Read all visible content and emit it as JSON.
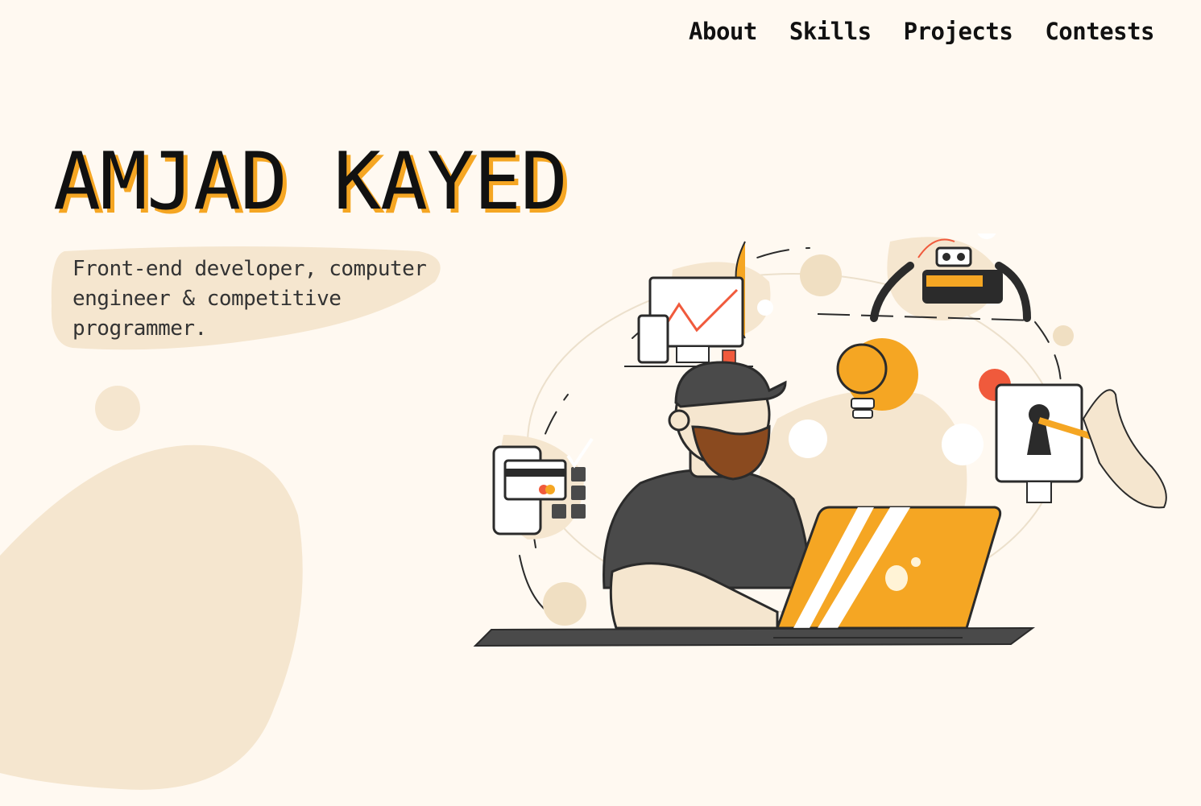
{
  "nav": {
    "items": [
      {
        "label": "About"
      },
      {
        "label": "Skills"
      },
      {
        "label": "Projects"
      },
      {
        "label": "Contests"
      }
    ]
  },
  "hero": {
    "name": "AMJAD KAYED",
    "tagline": "Front-end developer, computer engineer & competitive programmer."
  },
  "colors": {
    "background": "#fff9f1",
    "accent": "#f5a623",
    "blob": "#f5e6cf",
    "dark": "#4a4a4a"
  },
  "illustration": {
    "icons": [
      "chart-monitor-icon",
      "robot-spider-icon",
      "lightbulb-icon",
      "payment-phone-icon",
      "keyhole-monitor-icon",
      "developer-laptop-figure"
    ]
  }
}
